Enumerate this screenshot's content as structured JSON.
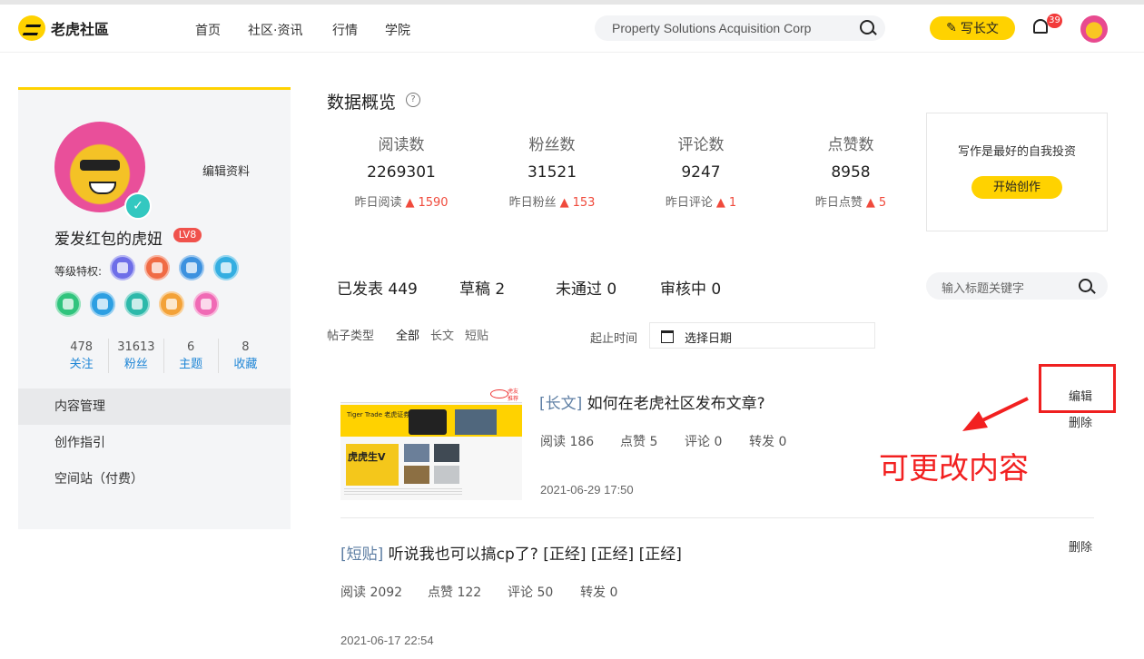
{
  "site": {
    "name": "老虎社區"
  },
  "nav": [
    "首页",
    "社区·资讯",
    "行情",
    "学院"
  ],
  "search": {
    "value": "Property Solutions Acquisition Corp"
  },
  "header": {
    "write_label": "写长文",
    "notification_count": "39"
  },
  "profile": {
    "edit_label": "编辑资料",
    "name": "爱发红包的虎妞",
    "level": "LV8",
    "privilege_label": "等级特权:",
    "stats": [
      {
        "value": "478",
        "label": "关注"
      },
      {
        "value": "31613",
        "label": "粉丝"
      },
      {
        "value": "6",
        "label": "主题"
      },
      {
        "value": "8",
        "label": "收藏"
      }
    ]
  },
  "side_menu": [
    "内容管理",
    "创作指引",
    "空间站（付费）"
  ],
  "overview": {
    "title": "数据概览",
    "metrics": [
      {
        "label": "阅读数",
        "value": "2269301",
        "change_label": "昨日阅读",
        "change": "1590"
      },
      {
        "label": "粉丝数",
        "value": "31521",
        "change_label": "昨日粉丝",
        "change": "153"
      },
      {
        "label": "评论数",
        "value": "9247",
        "change_label": "昨日评论",
        "change": "1"
      },
      {
        "label": "点赞数",
        "value": "8958",
        "change_label": "昨日点赞",
        "change": "5"
      }
    ],
    "invest_text": "写作是最好的自我投资",
    "start_label": "开始创作"
  },
  "post_tabs": [
    "已发表 449",
    "草稿 2",
    "未通过 0",
    "审核中 0"
  ],
  "title_search": {
    "placeholder": "输入标题关键字"
  },
  "filters": {
    "type_label": "帖子类型",
    "options": [
      "全部",
      "长文",
      "短贴"
    ],
    "date_label": "起止时间",
    "date_placeholder": "选择日期"
  },
  "posts": [
    {
      "tag": "[长文]",
      "title": "如何在老虎社区发布文章?",
      "reads": "阅读 186",
      "likes": "点赞 5",
      "comments": "评论 0",
      "shares": "转发 0",
      "date": "2021-06-29 17:50",
      "edit": "编辑",
      "delete": "删除"
    },
    {
      "tag": "[短贴]",
      "title": "听说我也可以搞cp了? [正经] [正经] [正经]",
      "reads": "阅读 2092",
      "likes": "点赞 122",
      "comments": "评论 50",
      "shares": "转发 0",
      "date": "2021-06-17 22:54",
      "delete": "删除"
    }
  ],
  "annotation": "可更改内容",
  "thumbnail": {
    "banner": "Tiger Trade 老虎证券",
    "headline": "虎虎生V",
    "side_tag": "虎友推荐"
  },
  "colors": {
    "accent": "#ffd200",
    "alert": "#f04a3c",
    "link": "#1f86d6"
  }
}
